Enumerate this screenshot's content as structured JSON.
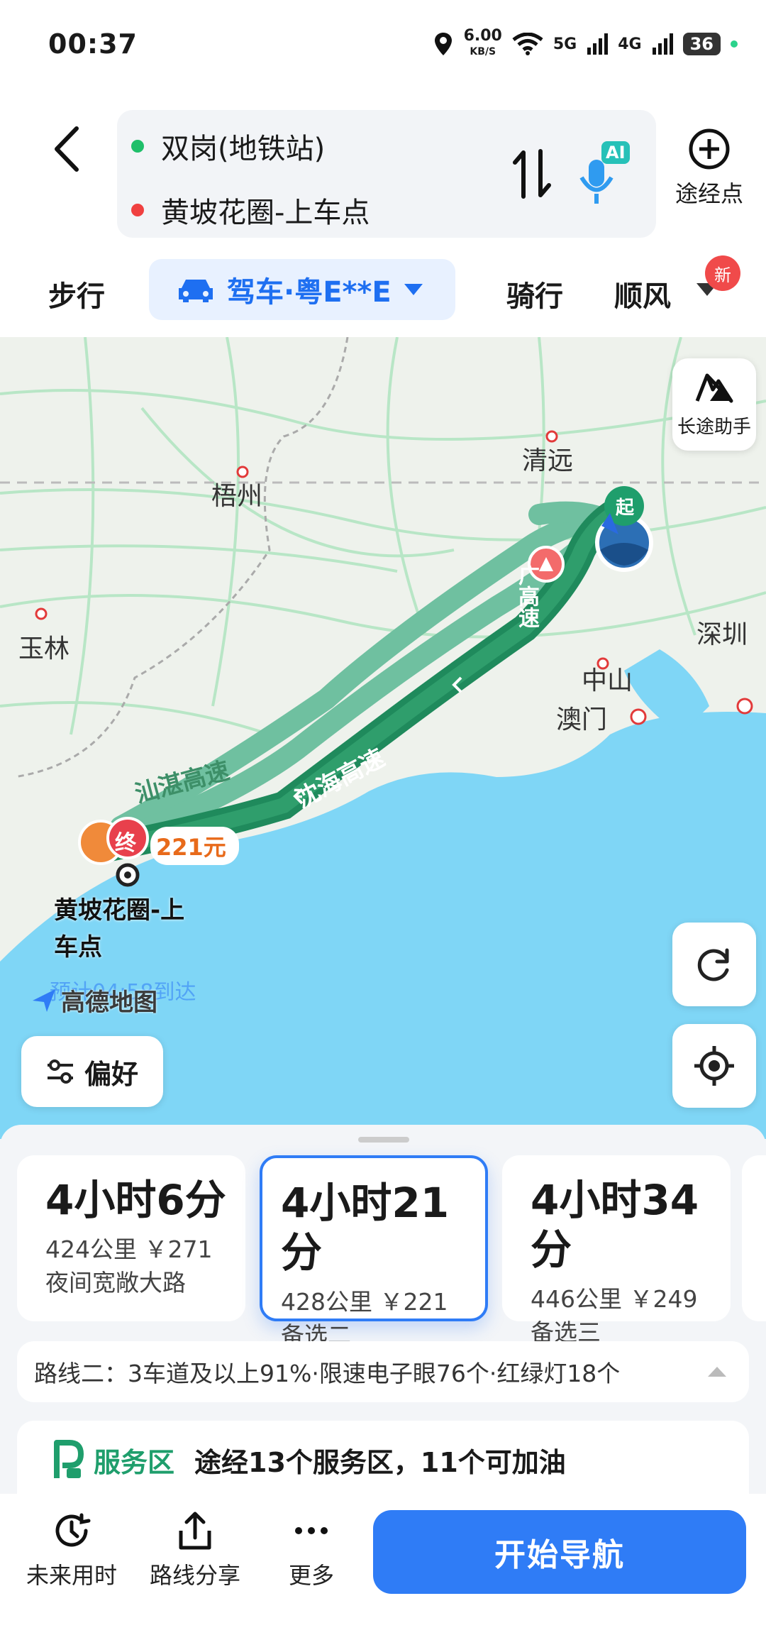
{
  "status_bar": {
    "time": "00:37",
    "net_speed": "6.00",
    "net_unit": "KB/S",
    "signal1": "5G",
    "signal2": "4G",
    "battery": "36"
  },
  "header": {
    "origin": "双岗(地铁站)",
    "destination": "黄坡花圈-上车点",
    "ai_label": "AI",
    "waypoint_label": "途经点"
  },
  "modes": {
    "walk": "步行",
    "drive": "驾车·粤E**E",
    "ride": "骑行",
    "carpool": "顺风",
    "new_badge": "新"
  },
  "map": {
    "long_trip_assistant": "长途助手",
    "cities": [
      "清远",
      "梧州",
      "玉林",
      "深圳",
      "中山",
      "澳门"
    ],
    "roads": [
      "沈海高速",
      "汕湛高速",
      "广高速"
    ],
    "start_marker": "起",
    "end_marker": "终",
    "price_tag": "221元",
    "end_label_line1": "黄坡花圈-上",
    "end_label_line2": "车点",
    "arrival_text": "预计04:58到达",
    "logo_text": "高德地图",
    "preference_label": "偏好"
  },
  "routes": [
    {
      "time": "4小时6分",
      "info": "424公里 ￥271",
      "desc": "夜间宽敞大路",
      "selected": false
    },
    {
      "time": "4小时21分",
      "info": "428公里 ￥221",
      "desc": "备选二",
      "selected": true
    },
    {
      "time": "4小时34分",
      "info": "446公里 ￥249",
      "desc": "备选三",
      "selected": false
    }
  ],
  "route_summary": "路线二：3车道及以上91%·限速电子眼76个·红绿灯18个",
  "service_area": {
    "title": "服务区",
    "text": "途经13个服务区，11个可加油"
  },
  "bottom_nav": {
    "future_time": "未来用时",
    "share": "路线分享",
    "more": "更多",
    "start": "开始导航"
  },
  "colors": {
    "primary": "#2f7cf6",
    "route_selected": "#1f8a5c",
    "route_alt": "#6fc0a0",
    "sea": "#7fd6f6",
    "land": "#eef2ec"
  }
}
